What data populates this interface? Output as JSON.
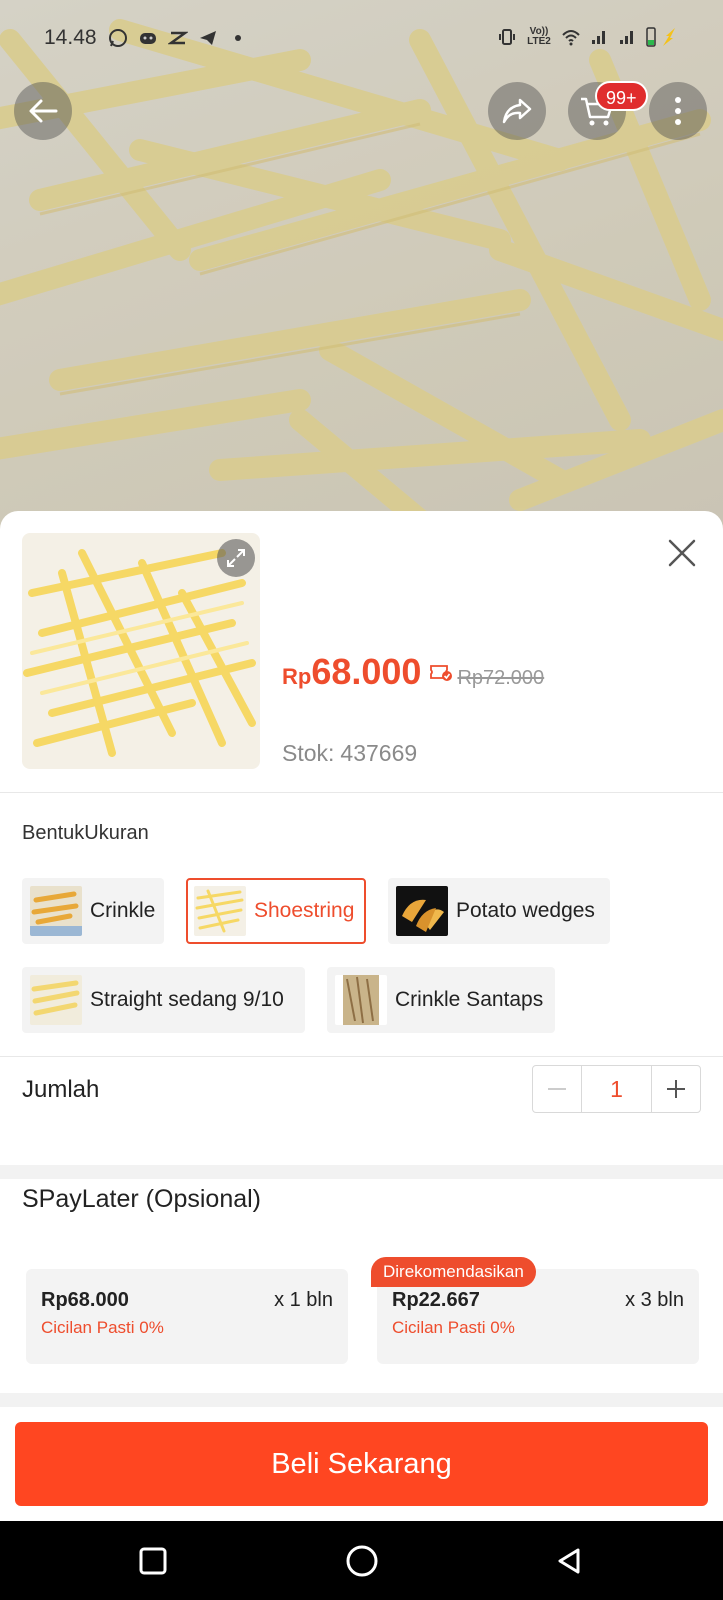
{
  "status_bar": {
    "time": "14.48",
    "network_label": "Vo)) LTE2",
    "left_icons": [
      "whatsapp-icon",
      "discord-icon",
      "capcut-icon",
      "telegram-icon",
      "dot-icon"
    ],
    "right_icons": [
      "vibrate-icon",
      "volte-icon",
      "wifi-icon",
      "signal-icon",
      "signal-icon",
      "battery-charging-icon"
    ]
  },
  "top_bar": {
    "cart_badge": "99+",
    "buttons": [
      "back-arrow-icon",
      "share-icon",
      "cart-icon",
      "more-vertical-icon"
    ]
  },
  "product": {
    "price_currency": "Rp",
    "price_amount": "68.000",
    "price_original": "Rp72.000",
    "stock_label": "Stok:",
    "stock_value": "437669"
  },
  "variants": {
    "title": "BentukUkuran",
    "options": [
      {
        "label": "Crinkle",
        "selected": false
      },
      {
        "label": "Shoestring",
        "selected": true
      },
      {
        "label": "Potato wedges",
        "selected": false
      },
      {
        "label": "Straight sedang 9/10",
        "selected": false
      },
      {
        "label": "Crinkle Santaps",
        "selected": false
      }
    ]
  },
  "quantity": {
    "label": "Jumlah",
    "value": "1"
  },
  "paylater": {
    "title": "SPayLater (Opsional)",
    "badge": "Direkomendasikan",
    "plans": [
      {
        "amount": "Rp68.000",
        "term": "x 1 bln",
        "note": "Cicilan Pasti 0%"
      },
      {
        "amount": "Rp22.667",
        "term": "x 3 bln",
        "note": "Cicilan Pasti 0%"
      }
    ]
  },
  "buy_button": "Beli Sekarang",
  "colors": {
    "accent": "#ee4d2d",
    "buy_button": "#ff4621",
    "badge": "#e02d2d"
  }
}
